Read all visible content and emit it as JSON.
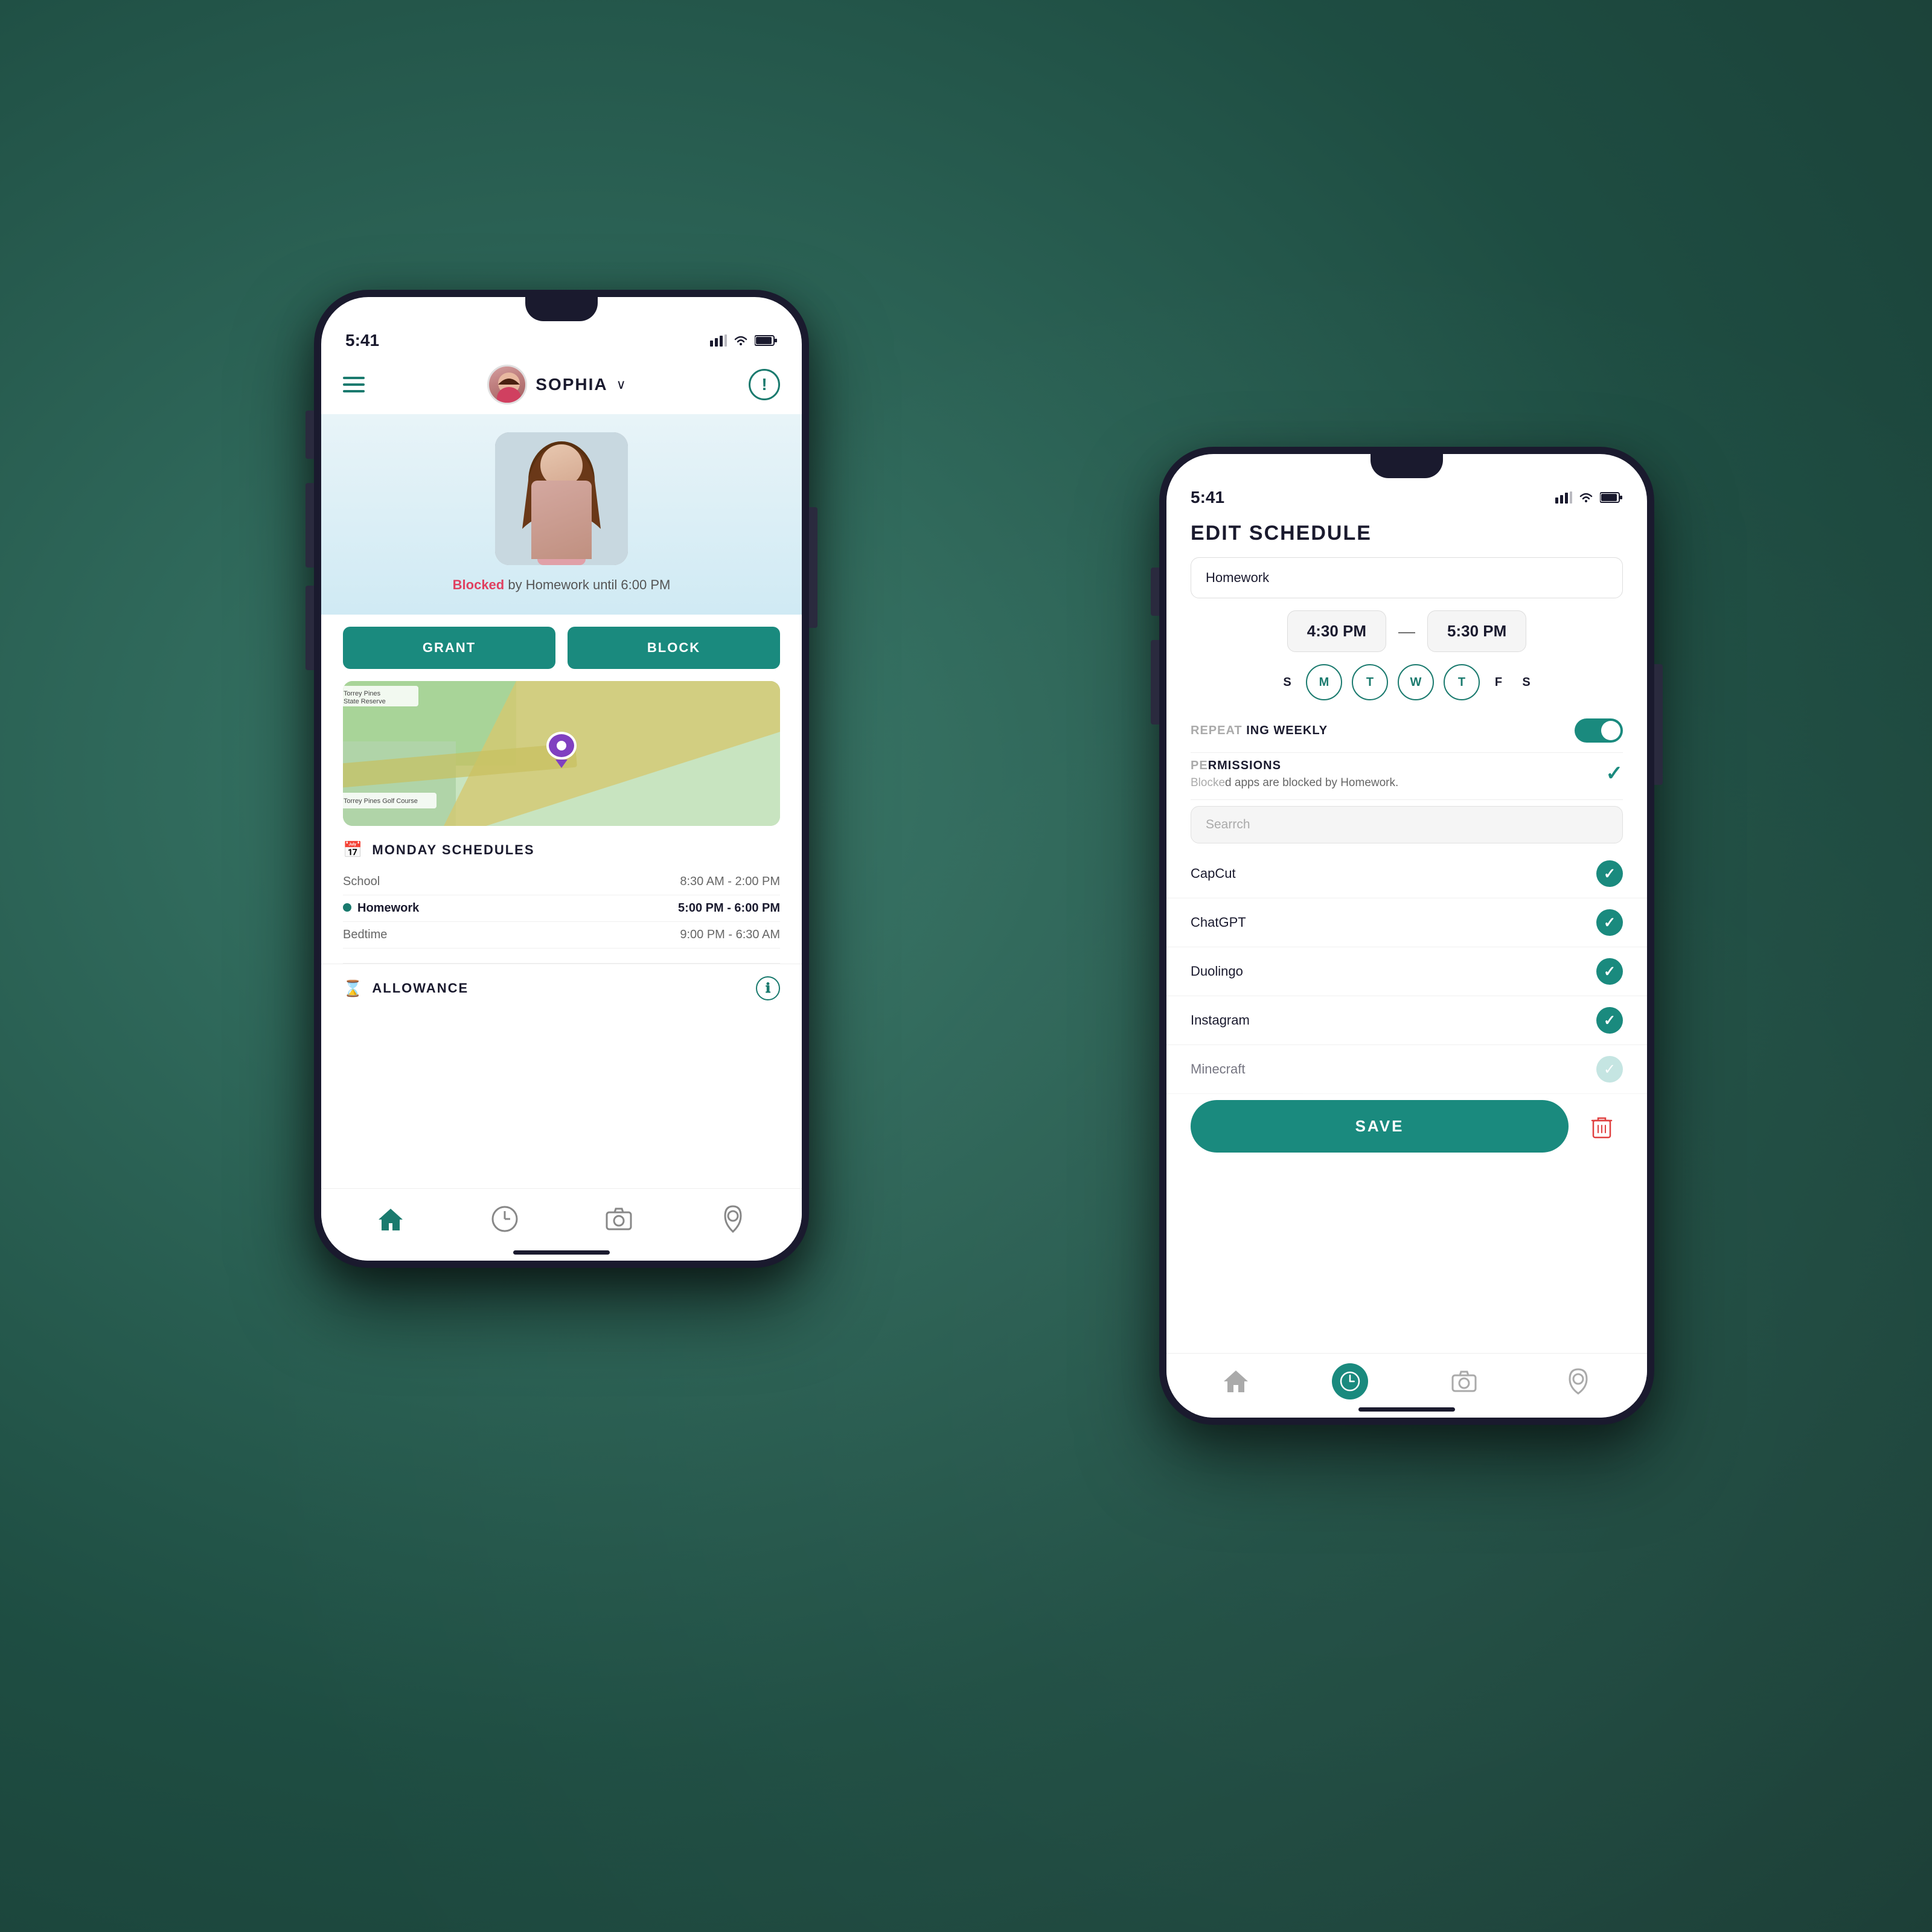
{
  "scene": {
    "background_color": "#2d6b5e"
  },
  "phone1": {
    "status_bar": {
      "time": "5:41",
      "signal": "▌▌▌",
      "wifi": "WiFi",
      "battery": "Battery"
    },
    "header": {
      "username": "SOPHIA",
      "chevron": "∨"
    },
    "profile": {
      "blocked_text": " by Homework until 6:00 PM",
      "blocked_word": "Blocked"
    },
    "buttons": {
      "grant": "GRANT",
      "block": "BLOCK"
    },
    "map": {
      "label1": "Torrey Pines\nState Reserve",
      "label2": "Torrey Pines Golf Course"
    },
    "schedules": {
      "title": "MONDAY SCHEDULES",
      "rows": [
        {
          "name": "School",
          "time": "8:30 AM - 2:00 PM",
          "bold": false,
          "dot": false
        },
        {
          "name": "Homework",
          "time": "5:00 PM - 6:00 PM",
          "bold": true,
          "dot": true
        },
        {
          "name": "Bedtime",
          "time": "9:00 PM - 6:30 AM",
          "bold": false,
          "dot": false
        }
      ]
    },
    "allowance": {
      "title": "ALLOWANCE"
    },
    "nav": {
      "home": "home",
      "clock": "clock",
      "camera": "camera",
      "location": "location"
    }
  },
  "phone2": {
    "status_bar": {
      "time": "5:41",
      "signal": "▌▌▌",
      "wifi": "WiFi",
      "battery": "Battery"
    },
    "header": {
      "title": "EDIT SCHEDULE"
    },
    "schedule_name_placeholder": "Homework",
    "time_start": "4:30 PM",
    "time_end": "5:30 PM",
    "days": {
      "s1": "S",
      "m": "M",
      "t1": "T",
      "w": "W",
      "t2": "T",
      "f": "F",
      "s2": "S"
    },
    "recurring_label": "ING WEEKLY",
    "permissions_label": "RMISSIONS",
    "permissions_desc": "d apps are blocked by Homework.",
    "search_placeholder": "rch",
    "apps": [
      {
        "name": "CapCut",
        "checked": true
      },
      {
        "name": "ChatGPT",
        "checked": true
      },
      {
        "name": "Duolingo",
        "checked": true
      },
      {
        "name": "Instagram",
        "checked": true
      },
      {
        "name": "Minecraft",
        "checked": "partial"
      }
    ],
    "save_button": "SAVE",
    "missions_blocked_text": "MISSIONS apps are blocked by Homework",
    "nav": {
      "home": "home",
      "clock": "clock",
      "camera": "camera",
      "location": "location"
    }
  }
}
